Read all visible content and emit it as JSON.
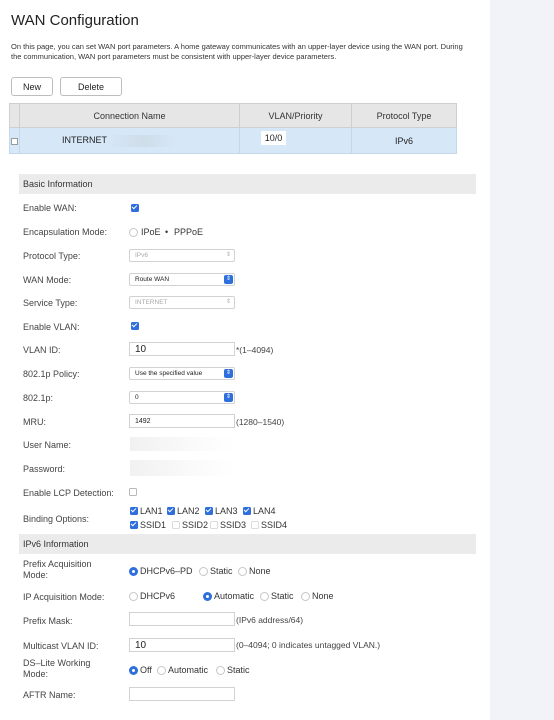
{
  "page": {
    "title": "WAN Configuration",
    "description": "On this page, you can set WAN port parameters. A home gateway communicates with an upper-layer device using the WAN port. During the communication, WAN port parameters must be consistent with upper-layer device parameters."
  },
  "toolbar": {
    "new_label": "New",
    "delete_label": "Delete"
  },
  "connections": {
    "headers": [
      "Connection Name",
      "VLAN/Priority",
      "Protocol Type"
    ],
    "rows": [
      {
        "name": "INTERNET",
        "vlan_priority": "10/0",
        "protocol": "IPv6"
      }
    ]
  },
  "basic": {
    "header": "Basic Information",
    "enable_wan_label": "Enable WAN:",
    "encap_label": "Encapsulation Mode:",
    "encap_options": [
      "IPoE",
      "PPPoE"
    ],
    "protocol_label": "Protocol Type:",
    "protocol_value": "IPv6",
    "wan_mode_label": "WAN Mode:",
    "wan_mode_value": "Route WAN",
    "service_label": "Service Type:",
    "service_value": "INTERNET",
    "enable_vlan_label": "Enable VLAN:",
    "vlan_id_label": "VLAN ID:",
    "vlan_id_value": "10",
    "vlan_id_hint": "*(1–4094)",
    "policy_label": "802.1p Policy:",
    "policy_value": "Use the specified value",
    "p8021_label": "802.1p:",
    "p8021_value": "0",
    "mru_label": "MRU:",
    "mru_value": "1492",
    "mru_hint": "(1280–1540)",
    "username_label": "User Name:",
    "password_label": "Password:",
    "lcp_label": "Enable LCP Detection:",
    "binding_label": "Binding Options:",
    "binding": {
      "lan1": "LAN1",
      "lan2": "LAN2",
      "lan3": "LAN3",
      "lan4": "LAN4",
      "ssid1": "SSID1",
      "ssid2": "SSID2",
      "ssid3": "SSID3",
      "ssid4": "SSID4"
    }
  },
  "ipv6": {
    "header": "IPv6 Information",
    "prefix_acq_label_1": "Prefix Acquisition",
    "prefix_acq_label_2": "Mode:",
    "prefix_acq_options": [
      "DHCPv6–PD",
      "Static",
      "None"
    ],
    "ip_acq_label": "IP Acquisition Mode:",
    "ip_acq_options": [
      "DHCPv6",
      "Automatic",
      "Static",
      "None"
    ],
    "prefix_mask_label": "Prefix Mask:",
    "prefix_mask_hint": "(IPv6 address/64)",
    "mcast_label": "Multicast VLAN ID:",
    "mcast_value": "10",
    "mcast_hint": "(0–4094; 0 indicates untagged VLAN.)",
    "dslite_label_1": "DS–Lite Working",
    "dslite_label_2": "Mode:",
    "dslite_options": [
      "Off",
      "Automatic",
      "Static"
    ],
    "aftr_label": "AFTR Name:"
  },
  "colors": {
    "accent": "#2e6fdc",
    "selected_row": "#d6e7f8",
    "section_bar": "#ebebeb"
  }
}
